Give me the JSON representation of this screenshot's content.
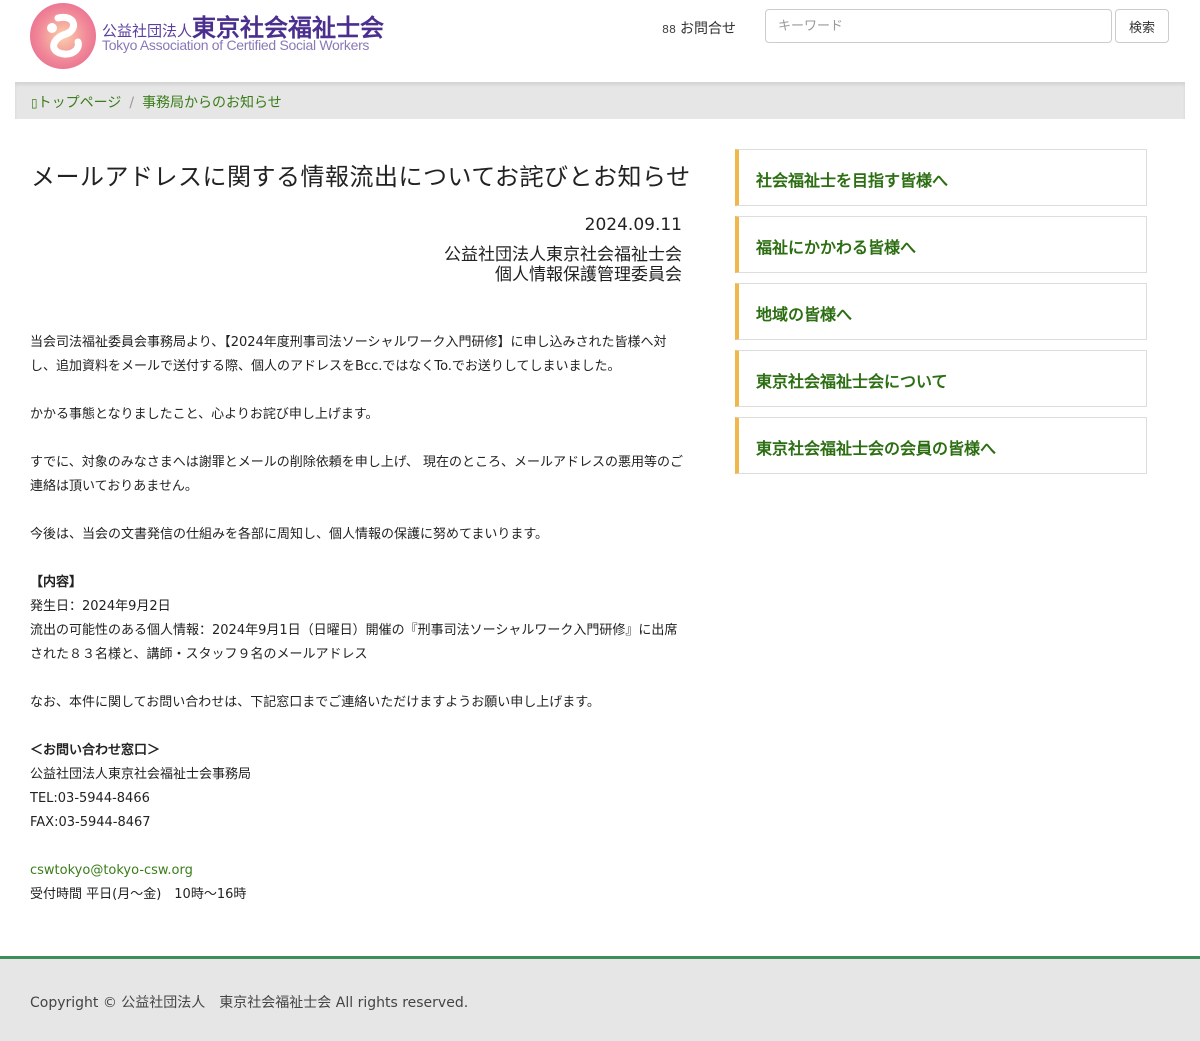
{
  "header": {
    "logo_small": "公益社団法人",
    "logo_big": "東京社会福祉士会",
    "logo_en": "Tokyo Association of Certified Social Workers",
    "contact_icon": "grid-icon",
    "contact_label": "お問合せ",
    "search_placeholder": "キーワード",
    "search_button": "検索"
  },
  "breadcrumb": {
    "home": "トップページ",
    "current": "事務局からのお知らせ"
  },
  "article": {
    "title": "メールアドレスに関する情報流出についてお詫びとお知らせ",
    "date": "2024.09.11",
    "org_line1": "公益社団法人東京社会福祉士会",
    "org_line2": "個人情報保護管理委員会",
    "p1": "当会司法福祉委員会事務局より、【2024年度刑事司法ソーシャルワーク入門研修】に申し込みされた皆様へ対し、追加資料をメールで送付する際、個人のアドレスをBcc.ではなくTo.でお送りしてしまいました。",
    "p2": "かかる事態となりましたこと、心よりお詫び申し上げます。",
    "p3": "すでに、対象のみなさまへは謝罪とメールの削除依頼を申し上げ、 現在のところ、メールアドレスの悪用等のご連絡は頂いておりあません。",
    "p4": "今後は、当会の文書発信の仕組みを各部に周知し、個人情報の保護に努めてまいります。",
    "content_heading": "【内容】",
    "content_date": "発生日：2024年9月2日",
    "content_info": "流出の可能性のある個人情報：2024年9月1日（日曜日）開催の『刑事司法ソーシャルワーク入門研修』に出席された８３名様と、講師・スタッフ９名のメールアドレス",
    "p5": "なお、本件に関してお問い合わせは、下記窓口までご連絡いただけますようお願い申し上げます。",
    "contact_heading": "＜お問い合わせ窓口＞",
    "contact_org": "公益社団法人東京社会福祉士会事務局",
    "contact_tel": "TEL:03-5944-8466",
    "contact_fax": "FAX:03-5944-8467",
    "contact_email": "cswtokyo@tokyo-csw.org",
    "contact_hours": "受付時間 平日(月～金)　10時～16時"
  },
  "sidebar": {
    "items": [
      {
        "label": "社会福祉士を目指す皆様へ"
      },
      {
        "label": "福祉にかかわる皆様へ"
      },
      {
        "label": "地域の皆様へ"
      },
      {
        "label": "東京社会福祉士会について"
      },
      {
        "label": "東京社会福祉士会の会員の皆様へ"
      }
    ]
  },
  "footer": {
    "copyright": "Copyright © 公益社団法人　東京社会福祉士会 All rights reserved."
  },
  "colors": {
    "link_green": "#3a7d1a",
    "sidebar_accent": "#f0b84a",
    "logo_purple": "#4a2f8f",
    "logo_pink": "#e86a8c",
    "footer_border": "#3c8f5a"
  }
}
